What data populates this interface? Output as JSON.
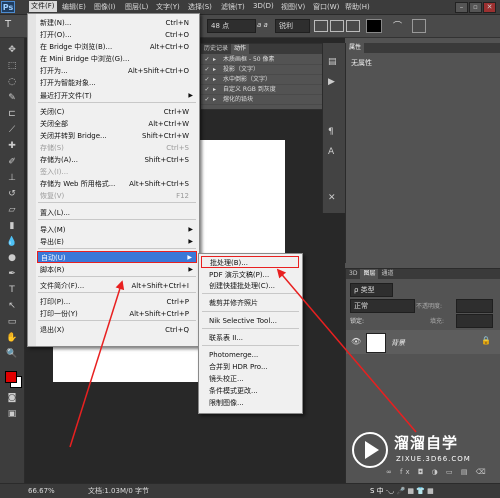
{
  "app": {
    "logo": "Ps"
  },
  "menubar": {
    "items": [
      "文件(F)",
      "编辑(E)",
      "图像(I)",
      "图层(L)",
      "文字(Y)",
      "选择(S)",
      "滤镜(T)",
      "3D(D)",
      "视图(V)",
      "窗口(W)",
      "帮助(H)"
    ]
  },
  "optbar": {
    "font_size": "48 点",
    "aa_mode": "锐利",
    "aa_prefix": "a a"
  },
  "history_panel": {
    "tabs": [
      "历史记录",
      "动作"
    ],
    "rows": [
      "木质画框 - 50 像素",
      "投影（文字）",
      "水中倒影（文字）",
      "自定义 RGB 到灰度",
      "熔化的铅块"
    ]
  },
  "properties_panel": {
    "tab": "属性",
    "content": "无属性"
  },
  "layers_panel": {
    "tabs": [
      "3D",
      "图层",
      "通道"
    ],
    "kind_label": "ρ 类型",
    "blend_mode": "正常",
    "opacity_label": "不透明度:",
    "lock_label": "锁定:",
    "fill_label": "填充:",
    "layer_name": "背景",
    "bottom_icons": "∞ fx ◘ ◑ ▭ ▤ ⌫"
  },
  "statusbar": {
    "zoom": "66.67%",
    "doc_info": "文档:1.03M/0 字节"
  },
  "file_menu": [
    {
      "label": "新建(N)...",
      "shortcut": "Ctrl+N"
    },
    {
      "label": "打开(O)...",
      "shortcut": "Ctrl+O"
    },
    {
      "label": "在 Bridge 中浏览(B)...",
      "shortcut": "Alt+Ctrl+O"
    },
    {
      "label": "在 Mini Bridge 中浏览(G)...",
      "shortcut": ""
    },
    {
      "label": "打开为...",
      "shortcut": "Alt+Shift+Ctrl+O"
    },
    {
      "label": "打开为智能对象...",
      "shortcut": ""
    },
    {
      "label": "最近打开文件(T)",
      "shortcut": "",
      "submenu": true
    },
    {
      "label": "关闭(C)",
      "shortcut": "Ctrl+W"
    },
    {
      "label": "关闭全部",
      "shortcut": "Alt+Ctrl+W"
    },
    {
      "label": "关闭并转到 Bridge...",
      "shortcut": "Shift+Ctrl+W"
    },
    {
      "label": "存储(S)",
      "shortcut": "Ctrl+S",
      "disabled": true
    },
    {
      "label": "存储为(A)...",
      "shortcut": "Shift+Ctrl+S"
    },
    {
      "label": "签入(I)...",
      "shortcut": "",
      "disabled": true
    },
    {
      "label": "存储为 Web 所用格式...",
      "shortcut": "Alt+Shift+Ctrl+S"
    },
    {
      "label": "恢复(V)",
      "shortcut": "F12",
      "disabled": true
    },
    {
      "label": "置入(L)...",
      "shortcut": ""
    },
    {
      "label": "导入(M)",
      "shortcut": "",
      "submenu": true
    },
    {
      "label": "导出(E)",
      "shortcut": "",
      "submenu": true
    },
    {
      "label": "自动(U)",
      "shortcut": "",
      "submenu": true,
      "highlighted": true
    },
    {
      "label": "脚本(R)",
      "shortcut": "",
      "submenu": true
    },
    {
      "label": "文件简介(F)...",
      "shortcut": "Alt+Shift+Ctrl+I"
    },
    {
      "label": "打印(P)...",
      "shortcut": "Ctrl+P"
    },
    {
      "label": "打印一份(Y)",
      "shortcut": "Alt+Shift+Ctrl+P"
    },
    {
      "label": "退出(X)",
      "shortcut": "Ctrl+Q"
    }
  ],
  "auto_submenu": [
    "批处理(B)...",
    "PDF 演示文稿(P)...",
    "创建快捷批处理(C)...",
    "裁剪并修齐照片",
    "Nik Selective Tool...",
    "联系表 II...",
    "Photomerge...",
    "合并到 HDR Pro...",
    "镜头校正...",
    "条件模式更改...",
    "限制图像..."
  ],
  "watermark": {
    "title": "溜溜自学",
    "url": "ZIXUE.3D66.COM"
  },
  "taskbar_glyphs": "S 中 ·◡ 🎤 ▦ 👕 ▦",
  "colors": {
    "highlight": "#3a78d8",
    "annotation_red": "#e82020",
    "foreground": "#e00000",
    "background": "#ffffff"
  }
}
